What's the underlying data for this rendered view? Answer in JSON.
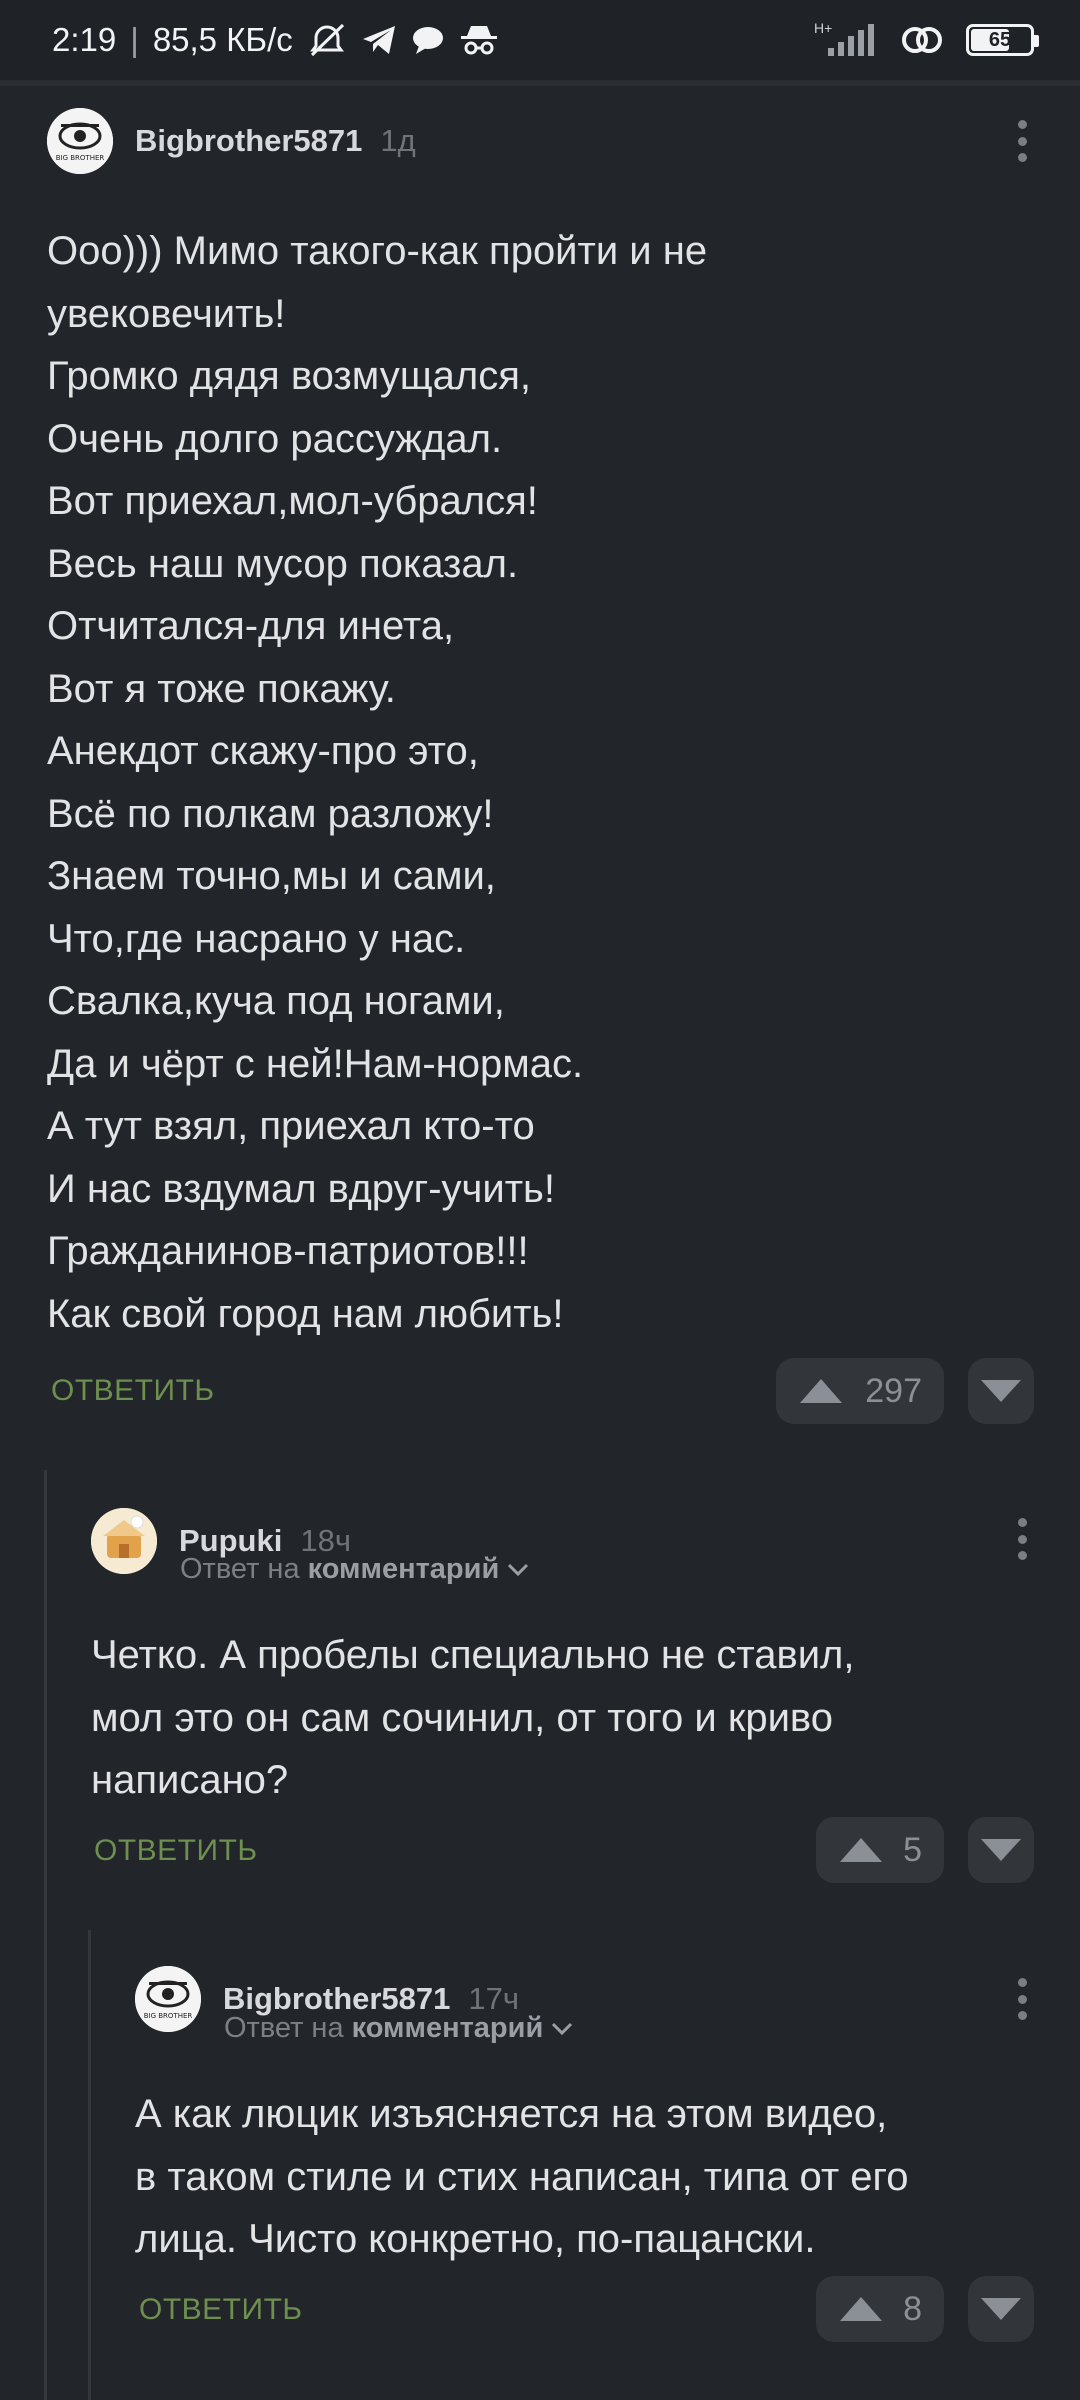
{
  "status_bar": {
    "time": "2:19",
    "separator": "|",
    "net_speed": "85,5 КБ/с",
    "network_type": "H+",
    "battery": "65",
    "icons": [
      "alarm-off-icon",
      "telegram-icon",
      "chat-bubble-icon",
      "incognito-icon",
      "signal-icon",
      "link-icon",
      "battery-icon"
    ]
  },
  "comments": [
    {
      "author": "Bigbrother5871",
      "time": "1д",
      "avatar": "bigbrother-avatar",
      "text": "Ооо))) Мимо такого-как пройти и не\nувековечить!\nГромко дядя возмущался,\nОчень долго рассуждал.\nВот приехал,мол-убрался!\nВесь наш мусор показал.\nОтчитался-для инета,\nВот я тоже покажу.\nАнекдот скажу-про это,\nВсё по полкам разложу!\nЗнаем точно,мы и сами,\nЧто,где насрано у нас.\nСвалка,куча под ногами,\nДа и чёрт с ней!Нам-нормас.\nА тут взял, приехал кто-то\nИ нас вздумал вдруг-учить!\nГражданинов-патриотов!!!\nКак свой город нам любить!",
      "reply_label": "ОТВЕТИТЬ",
      "votes": "297"
    },
    {
      "author": "Pupuki",
      "time": "18ч",
      "avatar": "pupuki-avatar",
      "reply_to_prefix": "Ответ на",
      "reply_to_target": "комментарий",
      "text": "Четко. А пробелы специально не ставил,\nмол это он сам сочинил, от того и криво\nнаписано?",
      "reply_label": "ОТВЕТИТЬ",
      "votes": "5"
    },
    {
      "author": "Bigbrother5871",
      "time": "17ч",
      "avatar": "bigbrother-avatar",
      "reply_to_prefix": "Ответ на",
      "reply_to_target": "комментарий",
      "text": "А как люцик изъясняется на этом видео,\nв таком стиле и стих написан, типа от его\nлица. Чисто конкретно, по-пацански.",
      "reply_label": "ОТВЕТИТЬ",
      "votes": "8"
    }
  ],
  "colors": {
    "background": "#222529",
    "reply_green": "#6d8f4f",
    "vote_bg": "#32363b"
  }
}
